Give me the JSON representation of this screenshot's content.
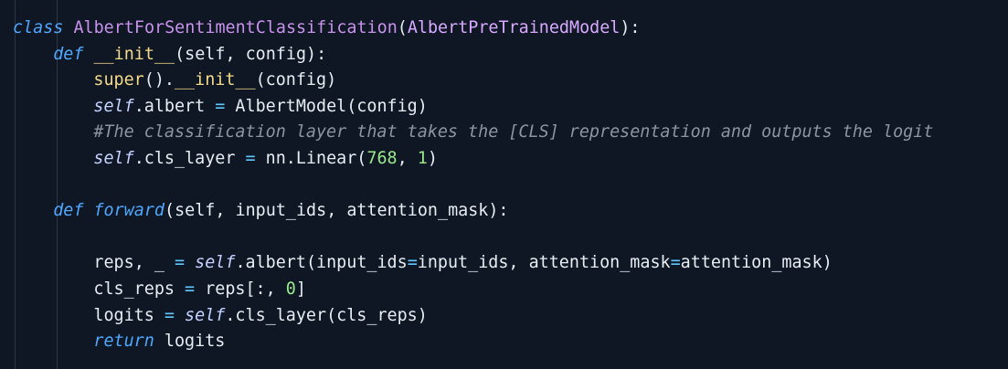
{
  "code": {
    "lines": [
      {
        "indent": 0,
        "tokens": [
          {
            "t": "class",
            "c": "kw"
          },
          {
            "t": " ",
            "c": "id"
          },
          {
            "t": "AlbertForSentimentClassification",
            "c": "class"
          },
          {
            "t": "(",
            "c": "punc"
          },
          {
            "t": "AlbertPreTrainedModel",
            "c": "fn"
          },
          {
            "t": "):",
            "c": "punc"
          }
        ]
      },
      {
        "indent": 1,
        "tokens": [
          {
            "t": "def",
            "c": "kw"
          },
          {
            "t": " ",
            "c": "id"
          },
          {
            "t": "__init__",
            "c": "func"
          },
          {
            "t": "(",
            "c": "punc"
          },
          {
            "t": "self",
            "c": "id"
          },
          {
            "t": ", ",
            "c": "punc"
          },
          {
            "t": "config",
            "c": "id"
          },
          {
            "t": "):",
            "c": "punc"
          }
        ]
      },
      {
        "indent": 2,
        "tokens": [
          {
            "t": "super",
            "c": "func"
          },
          {
            "t": "().",
            "c": "punc"
          },
          {
            "t": "__init__",
            "c": "func"
          },
          {
            "t": "(",
            "c": "punc"
          },
          {
            "t": "config",
            "c": "id"
          },
          {
            "t": ")",
            "c": "punc"
          }
        ]
      },
      {
        "indent": 2,
        "tokens": [
          {
            "t": "self",
            "c": "self"
          },
          {
            "t": ".",
            "c": "punc"
          },
          {
            "t": "albert",
            "c": "id"
          },
          {
            "t": " = ",
            "c": "op"
          },
          {
            "t": "AlbertModel",
            "c": "id"
          },
          {
            "t": "(",
            "c": "punc"
          },
          {
            "t": "config",
            "c": "id"
          },
          {
            "t": ")",
            "c": "punc"
          }
        ]
      },
      {
        "indent": 2,
        "tokens": [
          {
            "t": "#The classification layer that takes the [CLS] representation and outputs the logit",
            "c": "comment"
          }
        ]
      },
      {
        "indent": 2,
        "tokens": [
          {
            "t": "self",
            "c": "self"
          },
          {
            "t": ".",
            "c": "punc"
          },
          {
            "t": "cls_layer",
            "c": "id"
          },
          {
            "t": " = ",
            "c": "op"
          },
          {
            "t": "nn.Linear",
            "c": "id"
          },
          {
            "t": "(",
            "c": "punc"
          },
          {
            "t": "768",
            "c": "num"
          },
          {
            "t": ", ",
            "c": "punc"
          },
          {
            "t": "1",
            "c": "num"
          },
          {
            "t": ")",
            "c": "punc"
          }
        ]
      },
      {
        "indent": 1,
        "tokens": []
      },
      {
        "indent": 1,
        "tokens": [
          {
            "t": "def",
            "c": "kw"
          },
          {
            "t": " ",
            "c": "id"
          },
          {
            "t": "forward",
            "c": "kw"
          },
          {
            "t": "(",
            "c": "punc"
          },
          {
            "t": "self",
            "c": "id"
          },
          {
            "t": ", ",
            "c": "punc"
          },
          {
            "t": "input_ids",
            "c": "id"
          },
          {
            "t": ", ",
            "c": "punc"
          },
          {
            "t": "attention_mask",
            "c": "id"
          },
          {
            "t": "):",
            "c": "punc"
          }
        ]
      },
      {
        "indent": 2,
        "tokens": []
      },
      {
        "indent": 2,
        "tokens": [
          {
            "t": "reps",
            "c": "id"
          },
          {
            "t": ", ",
            "c": "punc"
          },
          {
            "t": "_",
            "c": "id"
          },
          {
            "t": " = ",
            "c": "op"
          },
          {
            "t": "self",
            "c": "self"
          },
          {
            "t": ".",
            "c": "punc"
          },
          {
            "t": "albert",
            "c": "id"
          },
          {
            "t": "(",
            "c": "punc"
          },
          {
            "t": "input_ids",
            "c": "id"
          },
          {
            "t": "=",
            "c": "op"
          },
          {
            "t": "input_ids",
            "c": "id"
          },
          {
            "t": ", ",
            "c": "punc"
          },
          {
            "t": "attention_mask",
            "c": "id"
          },
          {
            "t": "=",
            "c": "op"
          },
          {
            "t": "attention_mask",
            "c": "id"
          },
          {
            "t": ")",
            "c": "punc"
          }
        ]
      },
      {
        "indent": 2,
        "tokens": [
          {
            "t": "cls_reps",
            "c": "id"
          },
          {
            "t": " = ",
            "c": "op"
          },
          {
            "t": "reps",
            "c": "id"
          },
          {
            "t": "[:, ",
            "c": "punc"
          },
          {
            "t": "0",
            "c": "num"
          },
          {
            "t": "]",
            "c": "punc"
          }
        ]
      },
      {
        "indent": 2,
        "tokens": [
          {
            "t": "logits",
            "c": "id"
          },
          {
            "t": " = ",
            "c": "op"
          },
          {
            "t": "self",
            "c": "self"
          },
          {
            "t": ".",
            "c": "punc"
          },
          {
            "t": "cls_layer",
            "c": "id"
          },
          {
            "t": "(",
            "c": "punc"
          },
          {
            "t": "cls_reps",
            "c": "id"
          },
          {
            "t": ")",
            "c": "punc"
          }
        ]
      },
      {
        "indent": 2,
        "tokens": [
          {
            "t": "return",
            "c": "kw"
          },
          {
            "t": " ",
            "c": "id"
          },
          {
            "t": "logits",
            "c": "id"
          }
        ]
      }
    ]
  }
}
